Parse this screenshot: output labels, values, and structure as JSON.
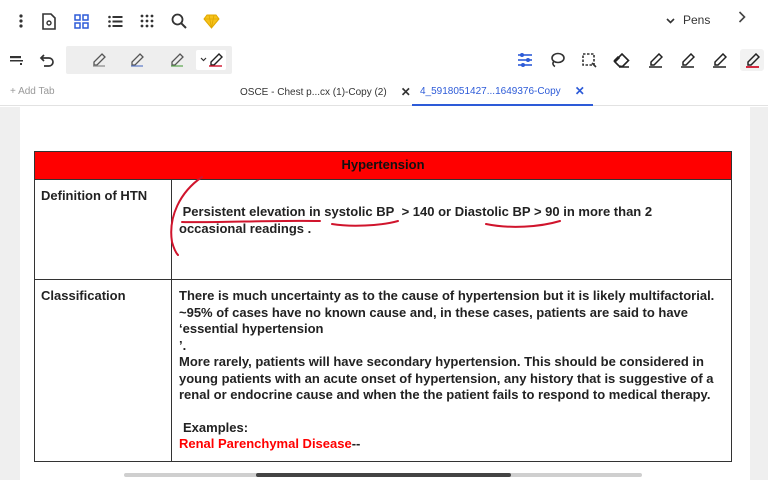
{
  "toolbar": {
    "pens_label": "Pens"
  },
  "tabs": {
    "add_tab": "+ Add Tab",
    "items": [
      {
        "label": "OSCE - Chest p...cx (1)-Copy (2)"
      },
      {
        "label": "4_5918051427...1649376-Copy"
      }
    ]
  },
  "document": {
    "table_title": "Hypertension",
    "rows": [
      {
        "label": "Definition  of HTN",
        "line1_parts": {
          "a": "Persistent elevation in systolic BP",
          "b": "> 140  or",
          "c": "Diastolic BP",
          "d": "> 90 in more than 2"
        },
        "line2": "occasional readings ."
      },
      {
        "label": "Classification",
        "para1": "There is much uncertainty as to the cause of hypertension but it is likely multifactorial. ~95% of cases have no known cause and, in these cases, patients are said to have ‘essential hypertension",
        "para1_end": "’.",
        "para2": "More rarely, patients will have secondary hypertension. This should be considered in young patients with an acute onset of hypertension, any history that is suggestive of a renal or endocrine cause and when the the patient fails to respond to medical therapy.",
        "examples_label": "Examples:",
        "example1": "Renal Parenchymal Disease",
        "example1_suffix": "--"
      }
    ]
  },
  "colors": {
    "accent": "#2d5bd8",
    "header_red": "#ff0000",
    "ink_red": "#d0142c"
  },
  "icons": [
    "more-vertical-icon",
    "document-icon",
    "grid-icon",
    "list-icon",
    "apps-icon",
    "search-icon",
    "diamond-icon",
    "chevron-down-icon",
    "chevron-right-icon",
    "highlighter-icon",
    "undo-icon",
    "pen-icon",
    "sliders-icon",
    "lasso-icon",
    "select-icon",
    "eraser-icon"
  ]
}
